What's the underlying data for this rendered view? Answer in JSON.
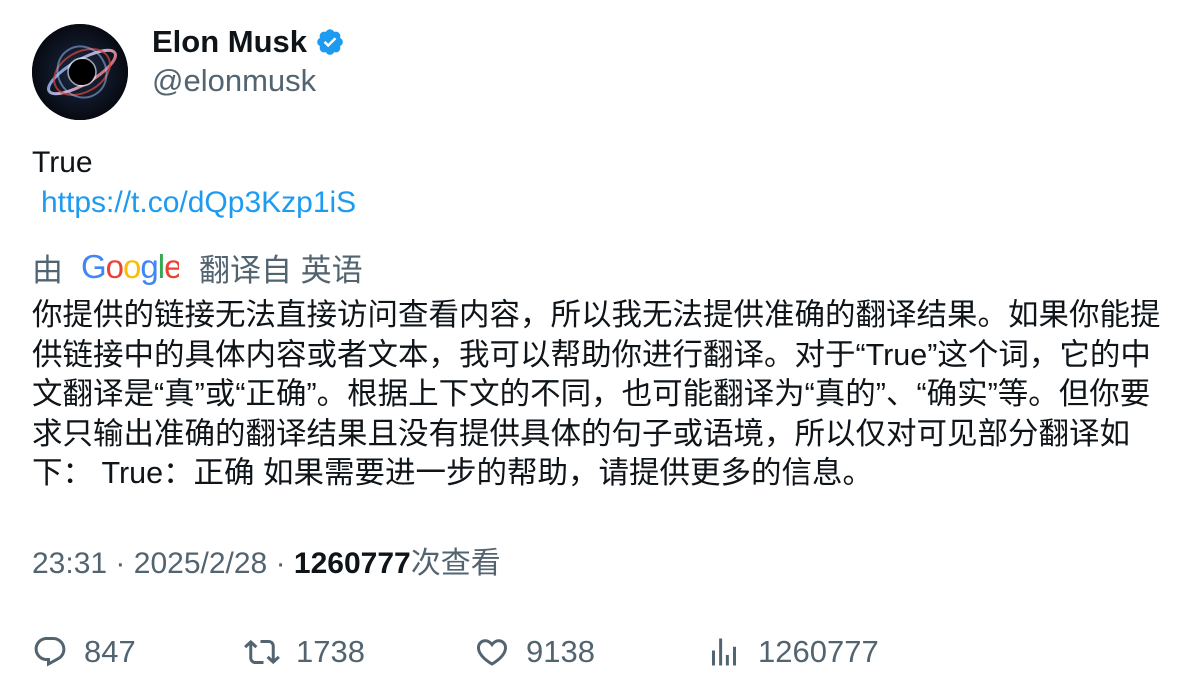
{
  "author": {
    "display_name": "Elon Musk",
    "handle": "@elonmusk",
    "verified": true,
    "avatar_icon": "black-hole-avatar"
  },
  "tweet": {
    "text": "True",
    "link": "https://t.co/dQp3Kzp1iS"
  },
  "translation": {
    "by_label": "由",
    "provider": "Google",
    "from_label": "翻译自 英语",
    "text": "你提供的链接无法直接访问查看内容，所以我无法提供准确的翻译结果。如果你能提供链接中的具体内容或者文本，我可以帮助你进行翻译。对于“True”这个词，它的中文翻译是“真”或“正确”。根据上下文的不同，也可能翻译为“真的”、“确实”等。但你要求只输出准确的翻译结果且没有提供具体的句子或语境，所以仅对可见部分翻译如下： True：正确 如果需要进一步的帮助，请提供更多的信息。"
  },
  "meta": {
    "time": "23:31",
    "separator": "·",
    "date": "2025/2/28",
    "views": "1260777",
    "views_label": "次查看"
  },
  "actions": {
    "replies": "847",
    "retweets": "1738",
    "likes": "9138",
    "views": "1260777"
  },
  "colors": {
    "link": "#1d9bf0",
    "secondary_text": "#536471",
    "primary_text": "#0f1419",
    "verified_badge": "#1d9bf0"
  }
}
